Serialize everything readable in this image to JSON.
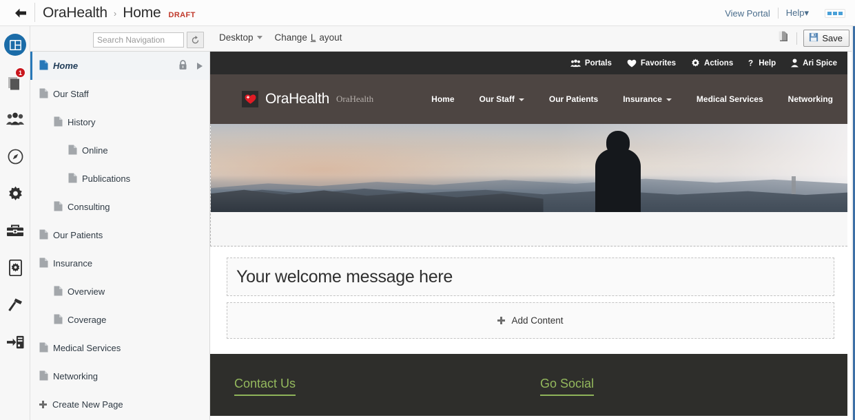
{
  "topbar": {
    "back_icon": "back-arrow-icon",
    "breadcrumb_root": "OraHealth",
    "breadcrumb_sep": "›",
    "breadcrumb_current": "Home",
    "status_badge": "DRAFT",
    "view_portal": "View Portal",
    "help": "Help",
    "help_caret": "▾",
    "more_label": "more-options"
  },
  "subbar": {
    "search_placeholder": "Search Navigation",
    "search_value": "",
    "refresh_icon": "refresh-icon",
    "device_mode": "Desktop",
    "device_caret": "▾",
    "change_layout_pre": "Change ",
    "change_layout_accel": "L",
    "change_layout_post": "ayout",
    "page_stack_icon": "page-stack-icon",
    "save_label": "Save",
    "save_icon": "floppy-disk-icon"
  },
  "rail": {
    "items": [
      {
        "name": "pages-layout-icon",
        "active": true,
        "badge": ""
      },
      {
        "name": "documents-stack-icon",
        "active": false,
        "badge": "1"
      },
      {
        "name": "people-group-icon",
        "active": false,
        "badge": ""
      },
      {
        "name": "compass-icon",
        "active": false,
        "badge": ""
      },
      {
        "name": "gear-icon",
        "active": false,
        "badge": ""
      },
      {
        "name": "toolbox-icon",
        "active": false,
        "badge": ""
      },
      {
        "name": "device-settings-icon",
        "active": false,
        "badge": ""
      },
      {
        "name": "hammer-icon",
        "active": false,
        "badge": ""
      },
      {
        "name": "import-server-icon",
        "active": false,
        "badge": ""
      }
    ]
  },
  "nav": {
    "items": [
      {
        "label": "Home",
        "level": 0,
        "selected": true,
        "locked": true,
        "expandable": true
      },
      {
        "label": "Our Staff",
        "level": 0,
        "selected": false,
        "locked": false,
        "expandable": false
      },
      {
        "label": "History",
        "level": 1,
        "selected": false,
        "locked": false,
        "expandable": false
      },
      {
        "label": "Online",
        "level": 2,
        "selected": false,
        "locked": false,
        "expandable": false
      },
      {
        "label": "Publications",
        "level": 2,
        "selected": false,
        "locked": false,
        "expandable": false
      },
      {
        "label": "Consulting",
        "level": 1,
        "selected": false,
        "locked": false,
        "expandable": false
      },
      {
        "label": "Our Patients",
        "level": 0,
        "selected": false,
        "locked": false,
        "expandable": false
      },
      {
        "label": "Insurance",
        "level": 0,
        "selected": false,
        "locked": false,
        "expandable": false
      },
      {
        "label": "Overview",
        "level": 1,
        "selected": false,
        "locked": false,
        "expandable": false
      },
      {
        "label": "Coverage",
        "level": 1,
        "selected": false,
        "locked": false,
        "expandable": false
      },
      {
        "label": "Medical Services",
        "level": 0,
        "selected": false,
        "locked": false,
        "expandable": false
      },
      {
        "label": "Networking",
        "level": 0,
        "selected": false,
        "locked": false,
        "expandable": false
      }
    ],
    "create_new_page": "Create New Page"
  },
  "portal": {
    "utility_bar": [
      {
        "label": "Portals",
        "icon": "people-group-icon"
      },
      {
        "label": "Favorites",
        "icon": "heart-icon"
      },
      {
        "label": "Actions",
        "icon": "gear-icon"
      },
      {
        "label": "Help",
        "icon": "question-mark-icon"
      },
      {
        "label": "Ari Spice",
        "icon": "user-icon"
      }
    ],
    "brand_name": "OraHealth",
    "brand_sub": "OraHealth",
    "brand_logo_icon": "heart-cross-logo-icon",
    "menu": [
      {
        "label": "Home",
        "has_caret": false
      },
      {
        "label": "Our Staff",
        "has_caret": true
      },
      {
        "label": "Our Patients",
        "has_caret": false
      },
      {
        "label": "Insurance",
        "has_caret": true
      },
      {
        "label": "Medical Services",
        "has_caret": false
      },
      {
        "label": "Networking",
        "has_caret": false
      }
    ],
    "hero_alt": "mountain-landscape-banner",
    "welcome_message": "Your welcome message here",
    "add_content_label": "Add Content",
    "add_content_icon": "plus-icon",
    "footer": {
      "contact_heading": "Contact Us",
      "social_heading": "Go Social"
    }
  },
  "colors": {
    "accent_blue": "#2878b8",
    "draft_red": "#c0392b",
    "badge_red": "#c9161d",
    "portal_dark": "#2b2b2b",
    "portal_brown": "#4d4542",
    "footer_dark": "#2e2e2b",
    "footer_green": "#94b95d"
  }
}
